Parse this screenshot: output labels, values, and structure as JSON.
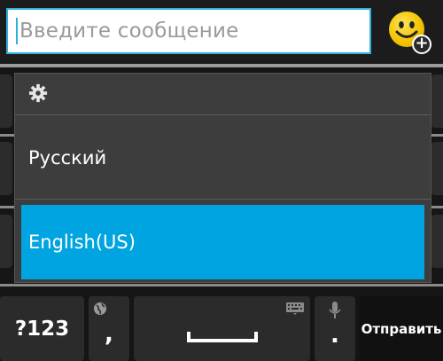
{
  "composer": {
    "placeholder": "Введите сообщение",
    "emoji_icon": "smiley-add-icon"
  },
  "language_menu": {
    "settings_icon": "gear-icon",
    "items": [
      {
        "label": "Русский",
        "selected": false
      },
      {
        "label": "English(US)",
        "selected": true
      }
    ],
    "selected_color": "#00a4e0"
  },
  "keyboard": {
    "symbols_label": "?123",
    "comma_label": ",",
    "comma_icon": "globe-icon",
    "space_icon": "keyboard-icon",
    "dot_label": ".",
    "dot_icon": "microphone-icon",
    "send_label": "Отправить"
  },
  "colors": {
    "accent": "#2fb0dd",
    "background": "#151515",
    "popup_bg": "#3d3d3d"
  }
}
